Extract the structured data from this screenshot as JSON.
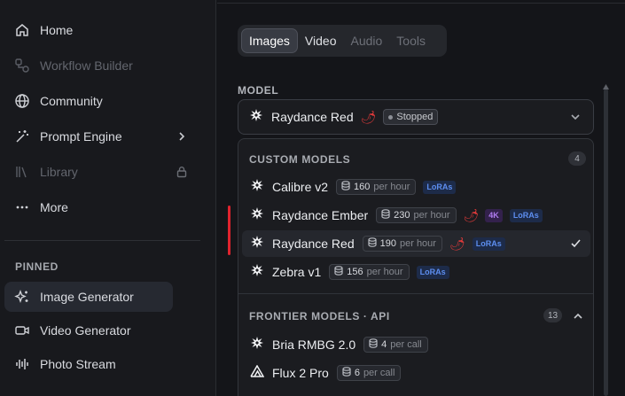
{
  "sidebar": {
    "items": [
      {
        "label": "Home",
        "icon": "home-icon",
        "disabled": false
      },
      {
        "label": "Workflow Builder",
        "icon": "workflow-icon",
        "disabled": true
      },
      {
        "label": "Community",
        "icon": "globe-icon",
        "disabled": false
      },
      {
        "label": "Prompt Engine",
        "icon": "magic-wand-icon",
        "disabled": false,
        "trailing": "chevron-right-icon"
      },
      {
        "label": "Library",
        "icon": "library-icon",
        "disabled": true,
        "trailing": "lock-icon"
      },
      {
        "label": "More",
        "icon": "more-icon",
        "disabled": false
      }
    ],
    "pinned_label": "PINNED",
    "pinned": [
      {
        "label": "Image Generator",
        "icon": "sparkles-icon",
        "active": true
      },
      {
        "label": "Video Generator",
        "icon": "video-icon",
        "active": false
      },
      {
        "label": "Photo Stream",
        "icon": "waveform-icon",
        "active": false
      }
    ]
  },
  "tabs": [
    {
      "label": "Images",
      "state": "selected"
    },
    {
      "label": "Video",
      "state": "enabled"
    },
    {
      "label": "Audio",
      "state": "disabled"
    },
    {
      "label": "Tools",
      "state": "disabled"
    }
  ],
  "model": {
    "label": "MODEL",
    "selected_name": "Raydance Red",
    "status": "Stopped"
  },
  "groups": [
    {
      "title": "CUSTOM MODELS",
      "count": "4",
      "models": [
        {
          "name": "Calibre v2",
          "price": "160",
          "unit": "per hour",
          "tags": [
            "LoRAs"
          ],
          "pepper": false,
          "selected": false
        },
        {
          "name": "Raydance Ember",
          "price": "230",
          "unit": "per hour",
          "tags": [
            "4K",
            "LoRAs"
          ],
          "pepper": true,
          "selected": false
        },
        {
          "name": "Raydance Red",
          "price": "190",
          "unit": "per hour",
          "tags": [
            "LoRAs"
          ],
          "pepper": true,
          "selected": true
        },
        {
          "name": "Zebra v1",
          "price": "156",
          "unit": "per hour",
          "tags": [
            "LoRAs"
          ],
          "pepper": false,
          "selected": false
        }
      ]
    },
    {
      "title": "FRONTIER MODELS · API",
      "count": "13",
      "models": [
        {
          "name": "Bria RMBG 2.0",
          "price": "4",
          "unit": "per call",
          "tags": [],
          "pepper": false,
          "selected": false
        },
        {
          "name": "Flux 2 Pro",
          "price": "6",
          "unit": "per call",
          "tags": [],
          "pepper": false,
          "selected": false
        }
      ]
    }
  ],
  "colors": {
    "background": "#141519",
    "sidebar": "#18191d",
    "accent_red": "#e0232e",
    "lora_text": "#5d8ef0",
    "k4_text": "#b07cf0"
  }
}
